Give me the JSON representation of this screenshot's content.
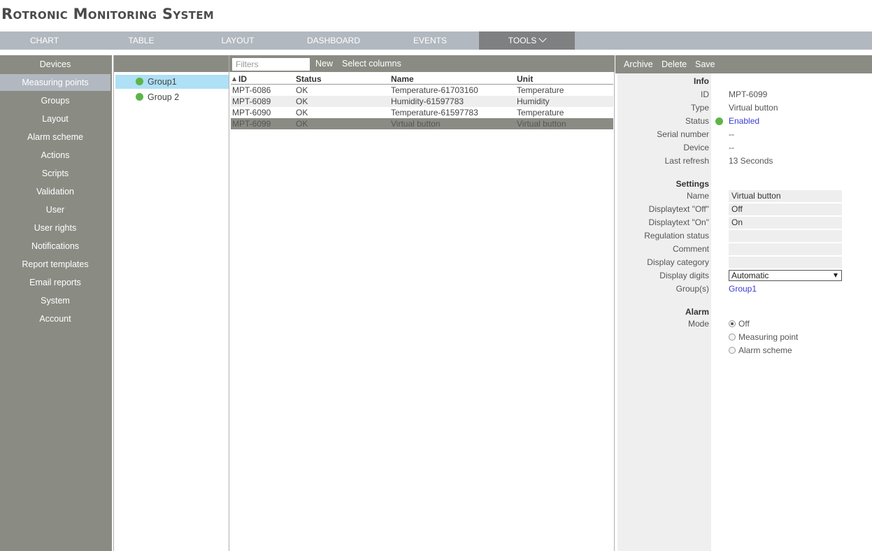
{
  "app": {
    "title": "Rotronic Monitoring System"
  },
  "topnav": {
    "tabs": [
      {
        "label": "CHART"
      },
      {
        "label": "TABLE"
      },
      {
        "label": "LAYOUT"
      },
      {
        "label": "DASHBOARD"
      },
      {
        "label": "EVENTS"
      },
      {
        "label": "TOOLS",
        "active": true
      }
    ]
  },
  "sidebar": {
    "active": "Measuring points",
    "items": [
      {
        "label": "Devices"
      },
      {
        "label": "Measuring points"
      },
      {
        "label": "Groups"
      },
      {
        "label": "Layout"
      },
      {
        "label": "Alarm scheme"
      },
      {
        "label": "Actions"
      },
      {
        "label": "Scripts"
      },
      {
        "label": "Validation"
      },
      {
        "label": "User"
      },
      {
        "label": "User rights"
      },
      {
        "label": "Notifications"
      },
      {
        "label": "Report templates"
      },
      {
        "label": "Email reports"
      },
      {
        "label": "System"
      },
      {
        "label": "Account"
      }
    ]
  },
  "groups": {
    "items": [
      {
        "label": "Group1",
        "selected": true
      },
      {
        "label": "Group 2"
      }
    ]
  },
  "table": {
    "filter_placeholder": "Filters",
    "new_label": "New",
    "select_columns_label": "Select columns",
    "columns": [
      "ID",
      "Status",
      "Name",
      "Unit"
    ],
    "rows": [
      {
        "id": "MPT-6086",
        "status": "OK",
        "name": "Temperature-61703160",
        "unit": "Temperature"
      },
      {
        "id": "MPT-6089",
        "status": "OK",
        "name": "Humidity-61597783",
        "unit": "Humidity"
      },
      {
        "id": "MPT-6090",
        "status": "OK",
        "name": "Temperature-61597783",
        "unit": "Temperature"
      },
      {
        "id": "MPT-6099",
        "status": "OK",
        "name": "Virtual button",
        "unit": "Virtual button",
        "selected": true
      }
    ]
  },
  "detail": {
    "toolbar": {
      "archive": "Archive",
      "delete": "Delete",
      "save": "Save"
    },
    "info": {
      "section": "Info",
      "id_label": "ID",
      "id": "MPT-6099",
      "type_label": "Type",
      "type": "Virtual button",
      "status_label": "Status",
      "status": "Enabled",
      "serial_label": "Serial number",
      "serial": "--",
      "device_label": "Device",
      "device": "--",
      "refresh_label": "Last refresh",
      "refresh": "13 Seconds"
    },
    "settings": {
      "section": "Settings",
      "name_label": "Name",
      "name": "Virtual button",
      "off_label": "Displaytext \"Off\"",
      "off": "Off",
      "on_label": "Displaytext \"On\"",
      "on": "On",
      "regulation_label": "Regulation status",
      "regulation": "",
      "comment_label": "Comment",
      "comment": "",
      "category_label": "Display category",
      "category": "",
      "digits_label": "Display digits",
      "digits": "Automatic",
      "groups_label": "Group(s)",
      "groups": "Group1"
    },
    "alarm": {
      "section": "Alarm",
      "mode_label": "Mode",
      "options": [
        "Off",
        "Measuring point",
        "Alarm scheme"
      ],
      "selected": "Off"
    }
  },
  "colors": {
    "sidebar_bg": "#8a8c84",
    "nav_bg": "#b2b8c0",
    "nav_active": "#7e8081",
    "status_green": "#5db548",
    "selected_group": "#aee0f6",
    "link": "#3b3bd1"
  }
}
